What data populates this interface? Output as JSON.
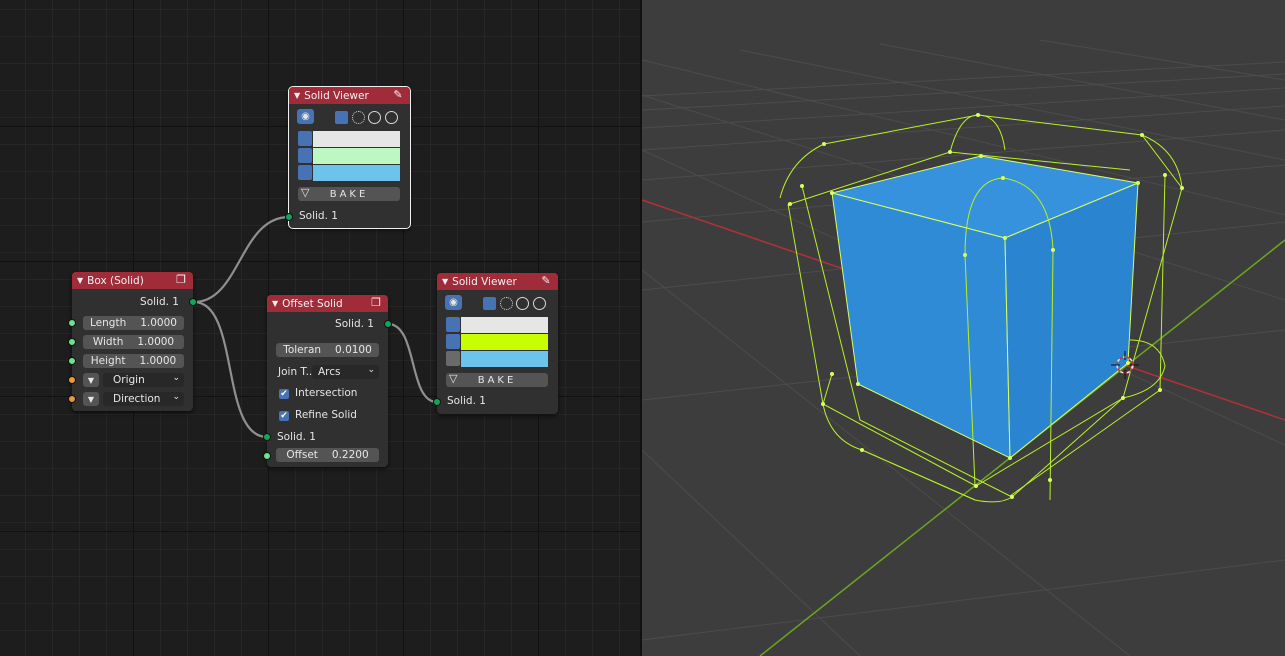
{
  "nodes": {
    "box": {
      "title": "Box (Solid)",
      "output": "Solid. 1",
      "length_label": "Length",
      "length_value": "1.0000",
      "width_label": "Width",
      "width_value": "1.0000",
      "height_label": "Height",
      "height_value": "1.0000",
      "origin_label": "Origin",
      "direction_label": "Direction"
    },
    "viewer_top": {
      "title": "Solid Viewer",
      "bake_label": "BAKE",
      "input": "Solid. 1",
      "colors": [
        "#e6e6e6",
        "#bdf7c4",
        "#6cc4ec"
      ]
    },
    "offset": {
      "title": "Offset Solid",
      "output": "Solid. 1",
      "tolerance_label": "Toleran",
      "tolerance_value": "0.0100",
      "join_label": "Join T...",
      "join_value": "Arcs",
      "intersection_label": "Intersection",
      "refine_label": "Refine Solid",
      "input": "Solid. 1",
      "offset_label": "Offset",
      "offset_value": "0.2200"
    },
    "viewer_right": {
      "title": "Solid Viewer",
      "bake_label": "BAKE",
      "input": "Solid. 1",
      "colors": [
        "#e6e6e6",
        "#c8ff00",
        "#6cc4ec"
      ]
    }
  },
  "colors": {
    "node_header": "#a02c3a",
    "cube_face": "#2f8bd6",
    "offset_wire": "#b8f028",
    "x_axis": "#b3303a",
    "y_axis": "#6aa61c"
  },
  "icons": {
    "header_pencil": "pencil-icon",
    "header_node": "node-copy-icon",
    "eye": "eye-icon",
    "cursor": "3d-cursor-icon"
  }
}
